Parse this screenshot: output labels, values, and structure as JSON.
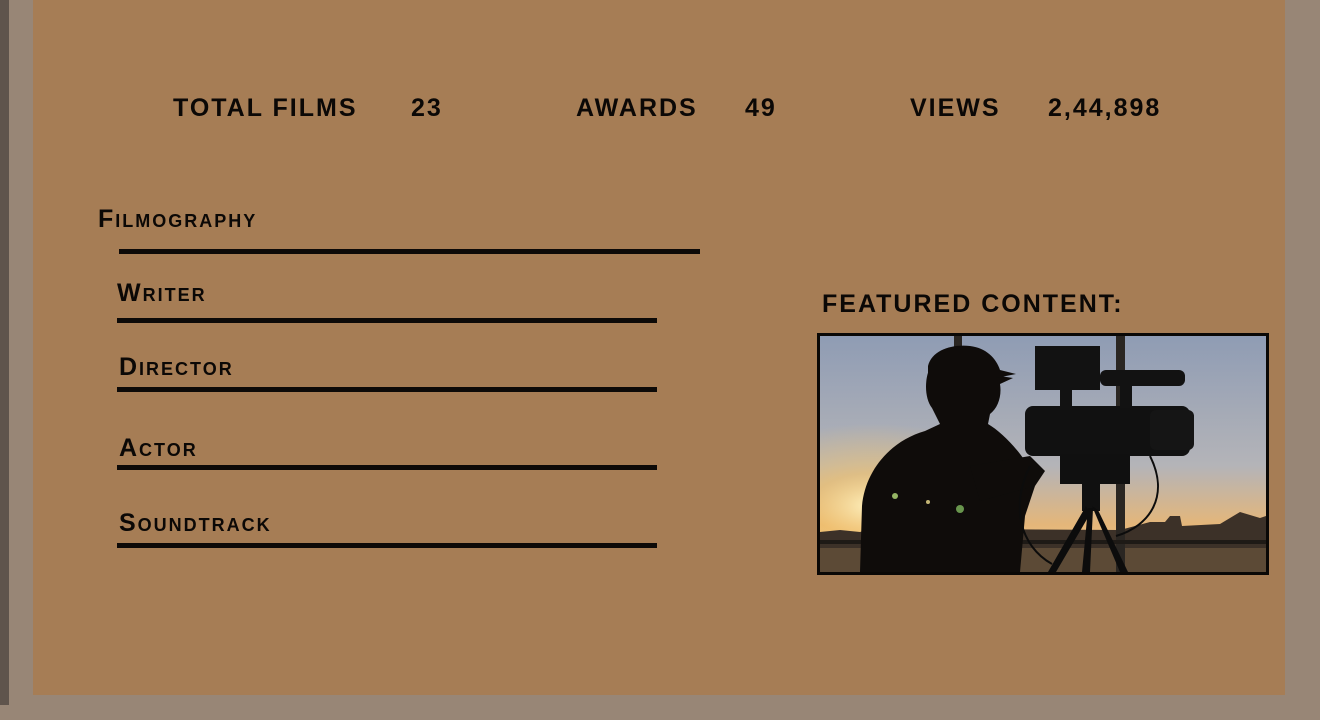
{
  "stats": {
    "total_films_label": "TOTAL FILMS",
    "total_films_value": "23",
    "awards_label": "AWARDS",
    "awards_value": "49",
    "views_label": "VIEWS",
    "views_value": "2,44,898"
  },
  "filmography": {
    "heading": "Filmography",
    "items": [
      {
        "label": "Writer"
      },
      {
        "label": "Director"
      },
      {
        "label": "Actor"
      },
      {
        "label": "Soundtrack"
      }
    ]
  },
  "featured": {
    "title": "FEATURED CONTENT:",
    "image_desc": "camera-operator-silhouette"
  },
  "colors": {
    "panel": "#a67d55",
    "outer": "#988676",
    "text": "#0b0806"
  }
}
